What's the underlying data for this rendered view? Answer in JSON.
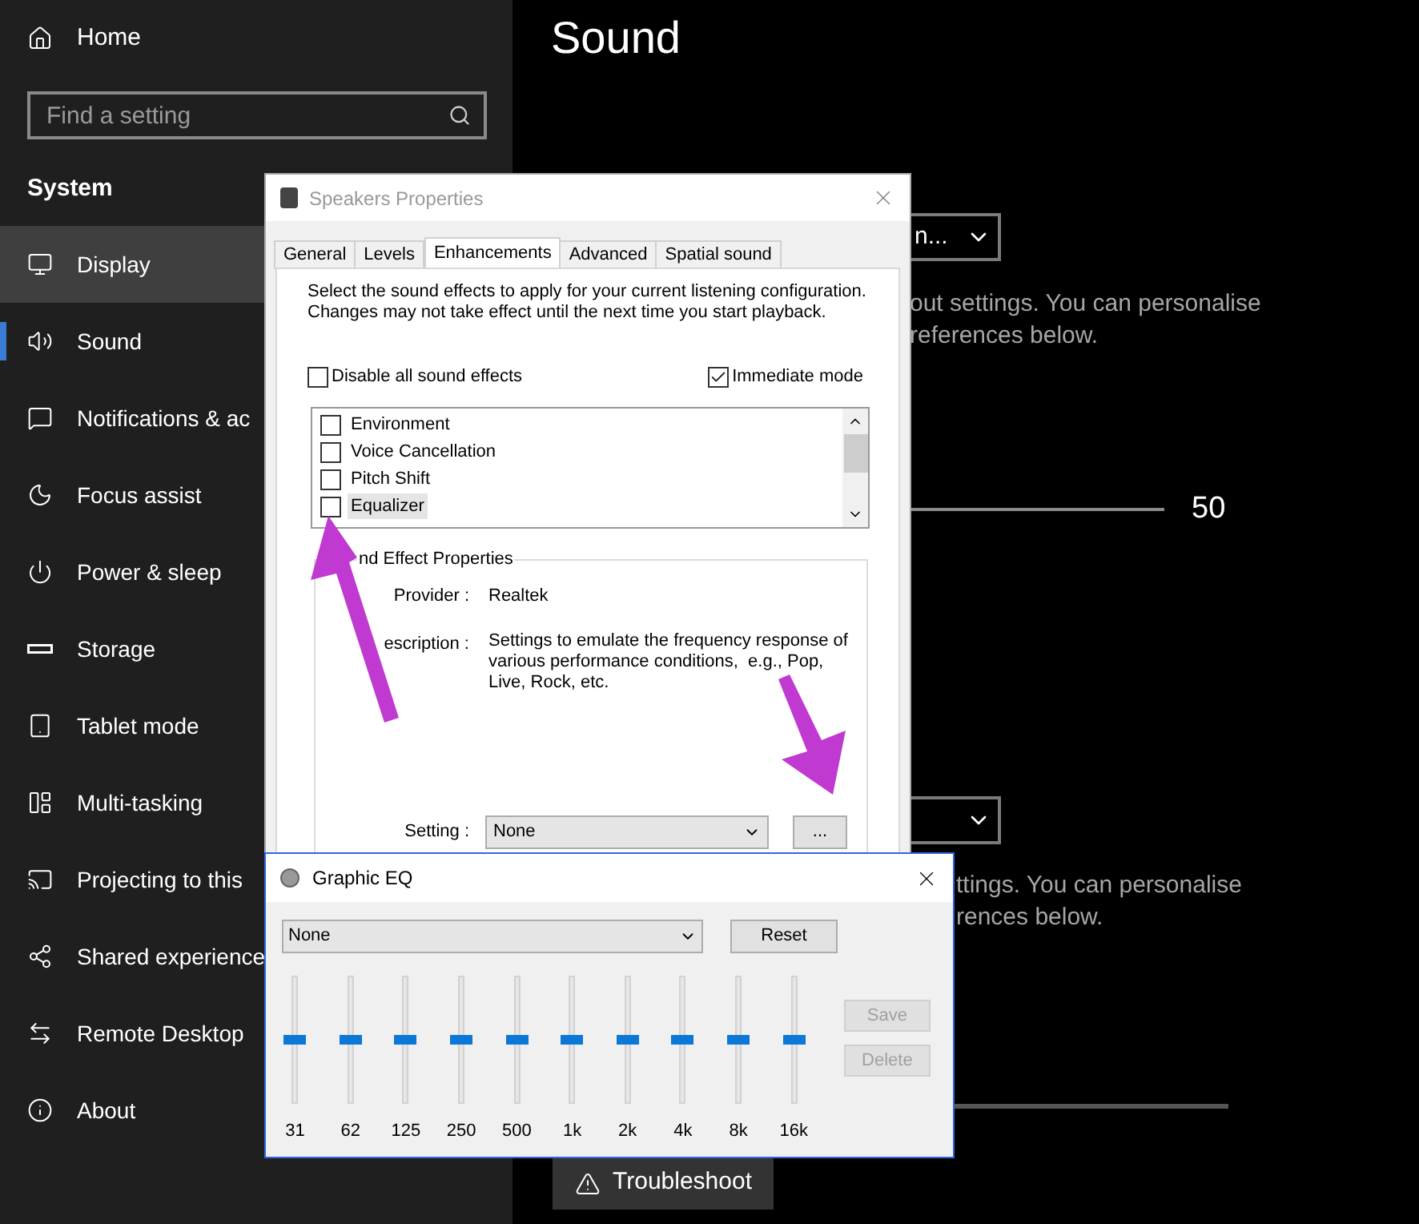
{
  "sidebar": {
    "home": "Home",
    "search": {
      "placeholder": "Find a setting"
    },
    "section": "System",
    "items": [
      {
        "label": "Display",
        "selected": false,
        "hovered": true
      },
      {
        "label": "Sound",
        "selected": true,
        "hovered": false
      },
      {
        "label": "Notifications & ac",
        "selected": false,
        "hovered": false
      },
      {
        "label": "Focus assist",
        "selected": false,
        "hovered": false
      },
      {
        "label": "Power & sleep",
        "selected": false,
        "hovered": false
      },
      {
        "label": "Storage",
        "selected": false,
        "hovered": false
      },
      {
        "label": "Tablet mode",
        "selected": false,
        "hovered": false
      },
      {
        "label": "Multi-tasking",
        "selected": false,
        "hovered": false
      },
      {
        "label": "Projecting to this",
        "selected": false,
        "hovered": false
      },
      {
        "label": "Shared experience",
        "selected": false,
        "hovered": false
      },
      {
        "label": "Remote Desktop",
        "selected": false,
        "hovered": false
      },
      {
        "label": "About",
        "selected": false,
        "hovered": false
      }
    ]
  },
  "settings": {
    "title": "Sound",
    "output_dropdown": "n...",
    "output_text": [
      "out settings. You can personalise",
      "references below."
    ],
    "volume": "50",
    "input_text": [
      "ttings. You can personalise",
      "rences below."
    ],
    "troubleshoot": "Troubleshoot"
  },
  "speakers_dialog": {
    "title": "Speakers Properties",
    "tabs": [
      {
        "label": "General",
        "selected": false
      },
      {
        "label": "Levels",
        "selected": false
      },
      {
        "label": "Enhancements",
        "selected": true
      },
      {
        "label": "Advanced",
        "selected": false
      },
      {
        "label": "Spatial sound",
        "selected": false
      }
    ],
    "intro": "Select the sound effects to apply for your current listening configuration. Changes may not take effect until the next time you start playback.",
    "disable_all": {
      "label": "Disable all sound effects",
      "checked": false
    },
    "immediate_mode": {
      "label": "Immediate mode",
      "checked": true
    },
    "effects": [
      {
        "label": "Environment",
        "checked": false,
        "selected": false
      },
      {
        "label": "Voice Cancellation",
        "checked": false,
        "selected": false
      },
      {
        "label": "Pitch Shift",
        "checked": false,
        "selected": false
      },
      {
        "label": "Equalizer",
        "checked": false,
        "selected": true
      }
    ],
    "properties": {
      "title": "nd Effect Properties",
      "provider_label": "Provider :",
      "provider": "Realtek",
      "description_label": "escription :",
      "description": "Settings to emulate the frequency response of various performance conditions,  e.g., Pop, Live, Rock, etc.",
      "setting_label": "Setting :",
      "setting": "None",
      "more": "..."
    }
  },
  "eq_window": {
    "title": "Graphic EQ",
    "preset": "None",
    "reset": "Reset",
    "bands": [
      {
        "label": "31",
        "level": 0.5
      },
      {
        "label": "62",
        "level": 0.5
      },
      {
        "label": "125",
        "level": 0.5
      },
      {
        "label": "250",
        "level": 0.5
      },
      {
        "label": "500",
        "level": 0.5
      },
      {
        "label": "1k",
        "level": 0.5
      },
      {
        "label": "2k",
        "level": 0.5
      },
      {
        "label": "4k",
        "level": 0.5
      },
      {
        "label": "8k",
        "level": 0.5
      },
      {
        "label": "16k",
        "level": 0.5
      }
    ],
    "save": {
      "label": "Save",
      "disabled": true
    },
    "delete": {
      "label": "Delete",
      "disabled": true
    }
  }
}
